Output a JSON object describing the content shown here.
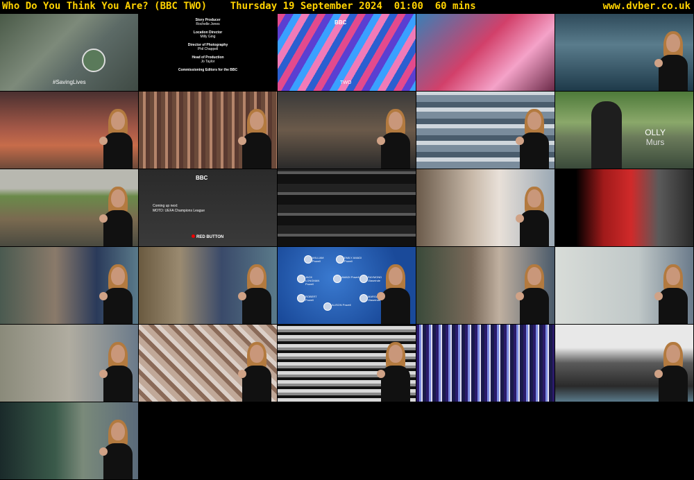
{
  "header": {
    "title": "Who Do You Think You Are? (BBC TWO)    Thursday 19 September 2024  01:00  60 mins",
    "site": "www.dvber.co.uk"
  },
  "colors": {
    "header_text": "#ffd200",
    "background": "#000000"
  },
  "thumbnails": [
    {
      "id": 1,
      "scene": "aerial-helipad",
      "caption": "#SavingLives"
    },
    {
      "id": 2,
      "scene": "end-credits"
    },
    {
      "id": 3,
      "scene": "bbc-two-ident",
      "logo": "BBC",
      "caption": "TWO"
    },
    {
      "id": 4,
      "scene": "dancer-stage"
    },
    {
      "id": 5,
      "scene": "stadium-signer"
    },
    {
      "id": 6,
      "scene": "athletics-signer"
    },
    {
      "id": 7,
      "scene": "crowd-flags-signer"
    },
    {
      "id": 8,
      "scene": "interview-room-signer"
    },
    {
      "id": 9,
      "scene": "glitch-signer"
    },
    {
      "id": 10,
      "scene": "olly-murs-park",
      "name_line1": "OLLY",
      "name_line2": "Murs"
    },
    {
      "id": 11,
      "scene": "country-road-signer"
    },
    {
      "id": 12,
      "scene": "red-button-promo",
      "logo": "BBC",
      "coming_up_1": "Coming up next:",
      "coming_up_2": "MOTD: UEFA Champions League",
      "caption": "RED BUTTON"
    },
    {
      "id": 13,
      "scene": "glitch-black"
    },
    {
      "id": 14,
      "scene": "woman-interview-signer"
    },
    {
      "id": 15,
      "scene": "football-fans"
    },
    {
      "id": 16,
      "scene": "elderly-man-signer"
    },
    {
      "id": 17,
      "scene": "elderly-couple-signer"
    },
    {
      "id": 18,
      "scene": "family-tree-signer",
      "tree": [
        "WILLIAM Powell",
        "EMILY AMADI Powell",
        "JACK LONGMAN Powell",
        "AMADI Powell",
        "RAYMOND Olaseinde",
        "ROBERT Powell",
        "MARGARETE Olaseinde",
        "ALISON Powell"
      ]
    },
    {
      "id": 19,
      "scene": "woman-smiling-signer"
    },
    {
      "id": 20,
      "scene": "document-signer"
    },
    {
      "id": 21,
      "scene": "blurred-signer"
    },
    {
      "id": 22,
      "scene": "pixelated-signer"
    },
    {
      "id": 23,
      "scene": "glitch-bars-signer"
    },
    {
      "id": 24,
      "scene": "blue-stripes-glitch"
    },
    {
      "id": 25,
      "scene": "archive-photo-signer"
    },
    {
      "id": 26,
      "scene": "dark-glitch-signer"
    }
  ],
  "credits": [
    {
      "role": "Story Producer",
      "name": "Rochelle Jones"
    },
    {
      "role": "Location Director",
      "name": "Milly Ging"
    },
    {
      "role": "Director of Photography",
      "name": "Phil Chappell"
    },
    {
      "role": "Head of Production",
      "name": "Jo Taylor"
    },
    {
      "role": "Commissioning Editors for the BBC",
      "name": ""
    }
  ]
}
